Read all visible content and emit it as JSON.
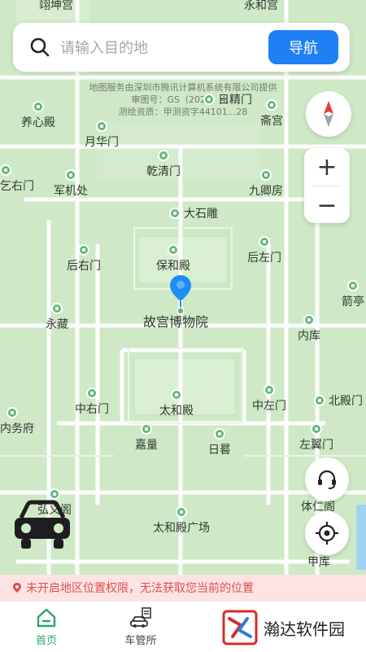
{
  "search": {
    "placeholder": "请输入目的地",
    "nav_label": "导航"
  },
  "watermark": {
    "line1": "地图服务由深圳市腾讯计算机系统有限公司提供",
    "line2": "审图号：GS（2024）4...",
    "line3": "测绘资质：甲测资字44101...28"
  },
  "map": {
    "top_labels": [
      "翊坤宫",
      "永和宫"
    ],
    "pois": {
      "yangxin": "养心殿",
      "riijing": "日精门",
      "zhaigong": "斋宫",
      "yuehua": "月华门",
      "qianqing": "乾清门",
      "junji": "军机处",
      "jiulong": "九卿房",
      "leftcut": "乞右门",
      "dashi": "大石雕",
      "baohe": "保和殿",
      "houyou": "后右门",
      "houzuo": "后左门",
      "jian": "箭亭",
      "yongzang": "永藏",
      "neiku": "内库",
      "taihe": "太和殿",
      "zhongyou": "中右门",
      "zhongzuo": "中左门",
      "beiduan": "北殿门",
      "neiwu": "内务府",
      "jialiang": "嘉量",
      "riqui": "日晷",
      "zuoyi": "左翼门",
      "tiren": "体仁阁",
      "hongyi": "弘义阁",
      "taiheguang": "太和殿广场",
      "jiaku": "甲库"
    },
    "center_label": "故宫博物院"
  },
  "controls": {
    "zoom_in": "+",
    "zoom_out": "−"
  },
  "notice": {
    "text": "未开启地区位置权限，无法获取您当前的位置"
  },
  "tabs": [
    {
      "label": "首页",
      "active": true
    },
    {
      "label": "车管所",
      "active": false
    }
  ],
  "brand": {
    "text": "瀚达软件园"
  },
  "colors": {
    "accent": "#1e80f4",
    "active_tab": "#2aa56b",
    "notice_bg": "#fde3e3",
    "notice_text": "#e04e4e",
    "map_green": "#cfe9c7"
  }
}
